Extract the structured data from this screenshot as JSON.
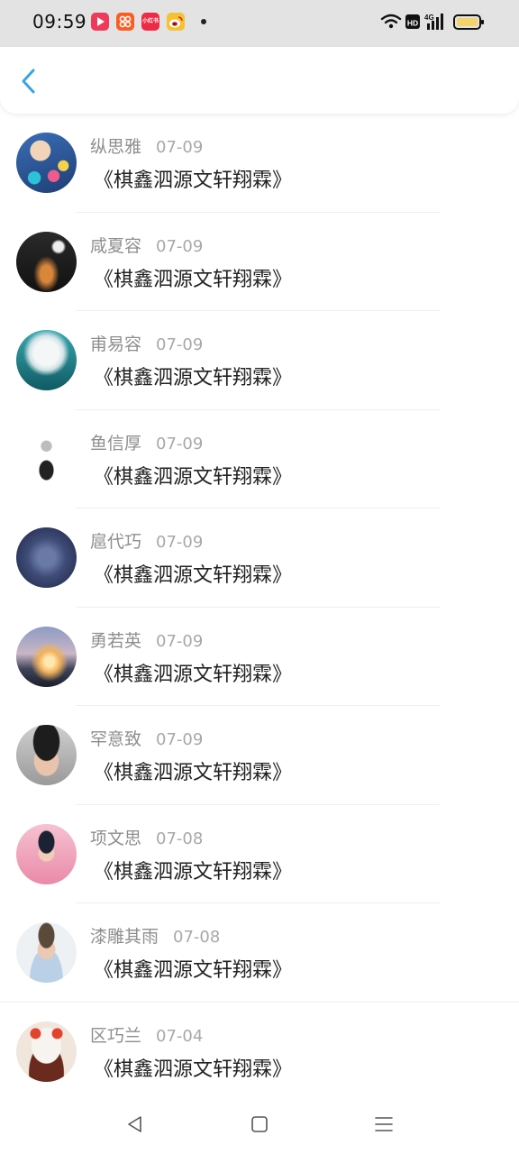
{
  "status_bar": {
    "time": "09:59",
    "apps": [
      {
        "icon": "video-app-icon",
        "color": "#ee3b5c"
      },
      {
        "icon": "shopping-app-icon",
        "color": "#ff5a1f"
      },
      {
        "icon": "xiaohongshu-app-icon",
        "color": "#ee2a45",
        "text": "小红书"
      },
      {
        "icon": "weibo-app-icon",
        "color": "#f5c330"
      }
    ],
    "hd_label": "HD",
    "network_label": "4G"
  },
  "header": {
    "back_icon": "chevron-left-icon",
    "accent_color": "#3aa3e3"
  },
  "messages": [
    {
      "name": "纵思雅",
      "date": "07-09",
      "text": "《棋鑫泗源文轩翔霖》"
    },
    {
      "name": "咸夏容",
      "date": "07-09",
      "text": "《棋鑫泗源文轩翔霖》"
    },
    {
      "name": "甫易容",
      "date": "07-09",
      "text": "《棋鑫泗源文轩翔霖》"
    },
    {
      "name": "鱼信厚",
      "date": "07-09",
      "text": "《棋鑫泗源文轩翔霖》"
    },
    {
      "name": "扈代巧",
      "date": "07-09",
      "text": "《棋鑫泗源文轩翔霖》"
    },
    {
      "name": "勇若英",
      "date": "07-09",
      "text": "《棋鑫泗源文轩翔霖》"
    },
    {
      "name": "罕意致",
      "date": "07-09",
      "text": "《棋鑫泗源文轩翔霖》"
    },
    {
      "name": "项文思",
      "date": "07-08",
      "text": "《棋鑫泗源文轩翔霖》"
    },
    {
      "name": "漆雕其雨",
      "date": "07-08",
      "text": "《棋鑫泗源文轩翔霖》"
    },
    {
      "name": "区巧兰",
      "date": "07-04",
      "text": "《棋鑫泗源文轩翔霖》"
    }
  ],
  "navbar": {
    "back_icon": "triangle-back-icon",
    "home_icon": "square-home-icon",
    "menu_icon": "menu-lines-icon"
  }
}
